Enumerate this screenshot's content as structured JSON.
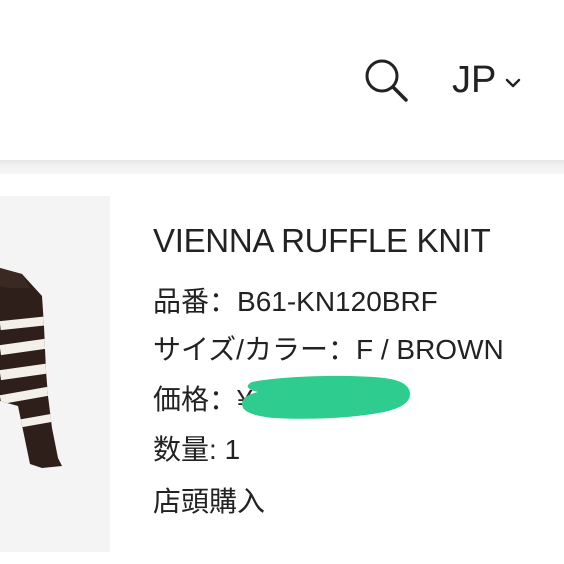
{
  "header": {
    "language_label": "JP",
    "search_icon": "search-icon",
    "language_icon": "chevron-down-icon"
  },
  "product": {
    "name": "VIENNA RUFFLE KNIT",
    "item_number_label": "品番：",
    "item_number": "B61-KN120BRF",
    "size_color_label": "サイズ/カラー：",
    "size_color": "F / BROWN",
    "price_label": "価格：",
    "price_visible_fragment": "¥",
    "quantity_label": "数量:",
    "quantity": "1",
    "purchase_method": "店頭購入"
  },
  "colors": {
    "text": "#222222",
    "redaction_mark": "#2ecc8f",
    "sweater_brown": "#2e1f1b",
    "sweater_stripe": "#f3efe9"
  }
}
